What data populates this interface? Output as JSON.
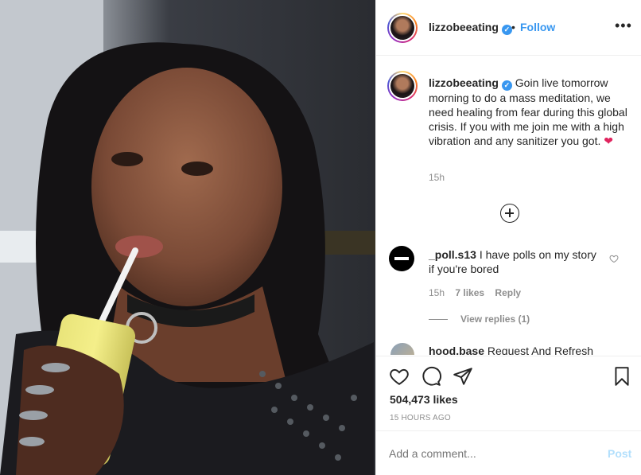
{
  "header": {
    "username": "lizzobeeating",
    "verified_mark": "✓",
    "separator": "•",
    "follow_label": "Follow",
    "more_label": "•••"
  },
  "caption": {
    "username": "lizzobeeating",
    "verified_mark": "✓",
    "text": "Goin live tomorrow morning to do a mass meditation, we need healing from fear during this global crisis. If you with me join me with a high vibration and any sanitizer you got.",
    "emoji": "❤",
    "time": "15h"
  },
  "comments": [
    {
      "username": "_poll.s13",
      "text": "I have polls on my story if you're bored",
      "time": "15h",
      "likes": "7 likes",
      "reply_label": "Reply",
      "view_replies": "View replies (1)"
    },
    {
      "username": "hood.base",
      "text": "Request And Refresh"
    }
  ],
  "actions": {
    "likes": "504,473 likes",
    "posted": "15 HOURS AGO"
  },
  "add_comment": {
    "placeholder": "Add a comment...",
    "post_label": "Post"
  },
  "icons": {
    "like": "heart-outline-icon",
    "comment": "comment-bubble-icon",
    "share": "paper-plane-icon",
    "save": "bookmark-icon",
    "load_more": "plus-circle-icon",
    "comment_like": "small-heart-icon"
  },
  "colors": {
    "link": "#3897f0",
    "post_disabled": "#b2dffc",
    "muted": "#8e8e8e",
    "heart": "#e0245e"
  }
}
